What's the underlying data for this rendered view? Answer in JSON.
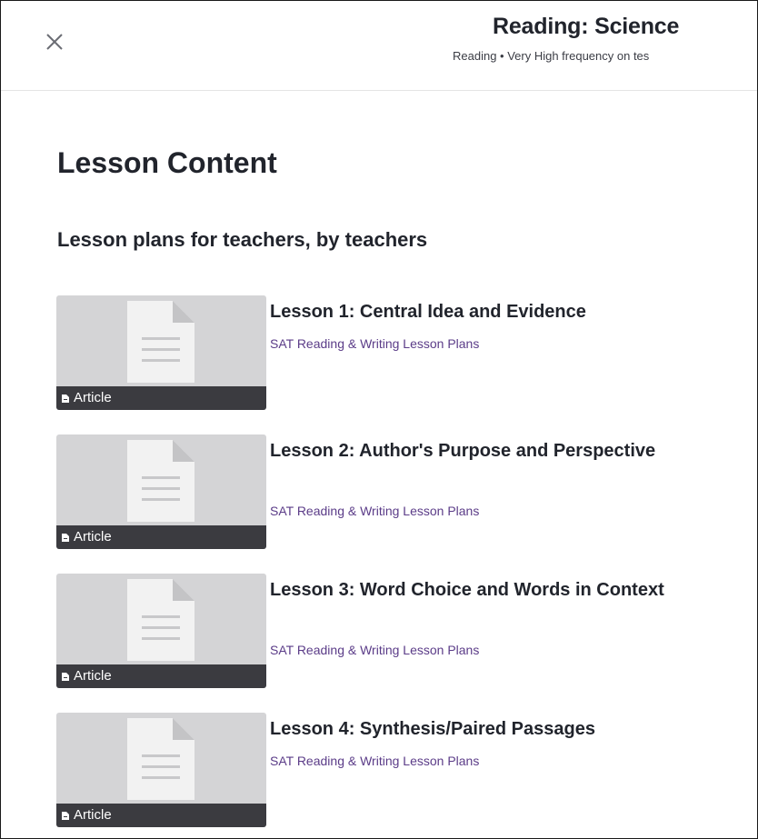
{
  "header": {
    "close_icon": "close-icon",
    "title": "Reading: Science",
    "subtitle": "Reading • Very High frequency on tes"
  },
  "content": {
    "title": "Lesson Content",
    "section_title": "Lesson plans for teachers, by teachers"
  },
  "lessons": [
    {
      "title": "Lesson 1: Central Idea and Evidence",
      "subtitle": "SAT Reading & Writing Lesson Plans",
      "badge": "Article",
      "icon": "document-icon"
    },
    {
      "title": "Lesson 2: Author's Purpose and Perspective",
      "subtitle": "SAT Reading & Writing Lesson Plans",
      "badge": "Article",
      "icon": "document-icon"
    },
    {
      "title": "Lesson 3: Word Choice and Words in Context",
      "subtitle": "SAT Reading & Writing Lesson Plans",
      "badge": "Article",
      "icon": "document-icon"
    },
    {
      "title": "Lesson 4: Synthesis/Paired Passages",
      "subtitle": "SAT Reading & Writing Lesson Plans",
      "badge": "Article",
      "icon": "document-icon"
    }
  ],
  "colors": {
    "subtitle_link": "#5b3c88",
    "thumbnail_bg": "#d4d4d6",
    "badge_bg": "#3b3b40"
  }
}
